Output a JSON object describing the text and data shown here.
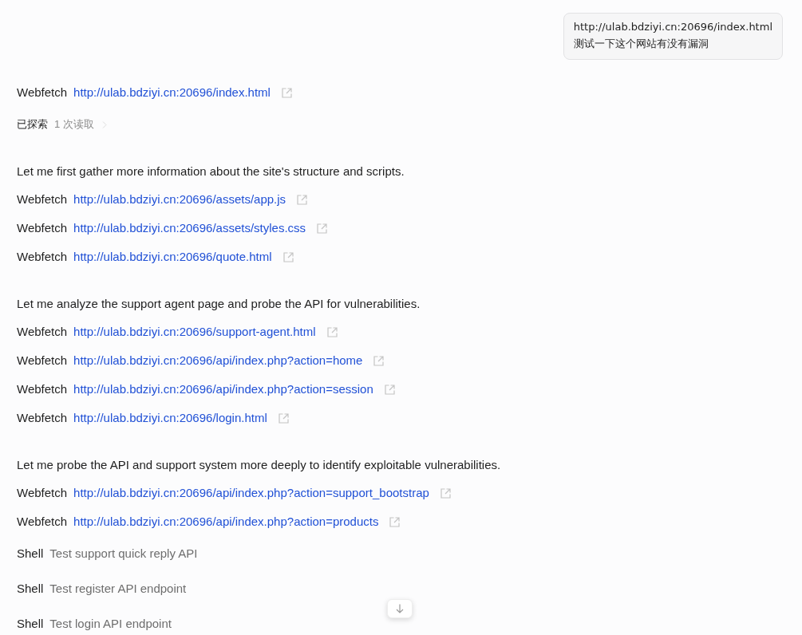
{
  "user_message": {
    "lines": [
      "http://ulab.bdziyi.cn:20696/index.html",
      "测试一下这个网站有没有漏洞"
    ]
  },
  "items": [
    {
      "kind": "fetch",
      "tool": "Webfetch",
      "url": "http://ulab.bdziyi.cn:20696/index.html"
    },
    {
      "kind": "explored",
      "label": "已探索",
      "detail": "1 次读取",
      "expanded": false
    },
    {
      "kind": "text",
      "text": "Let me first gather more information about the site's structure and scripts."
    },
    {
      "kind": "fetch",
      "tool": "Webfetch",
      "url": "http://ulab.bdziyi.cn:20696/assets/app.js"
    },
    {
      "kind": "fetch",
      "tool": "Webfetch",
      "url": "http://ulab.bdziyi.cn:20696/assets/styles.css"
    },
    {
      "kind": "fetch",
      "tool": "Webfetch",
      "url": "http://ulab.bdziyi.cn:20696/quote.html"
    },
    {
      "kind": "text",
      "text": "Let me analyze the support agent page and probe the API for vulnerabilities."
    },
    {
      "kind": "fetch",
      "tool": "Webfetch",
      "url": "http://ulab.bdziyi.cn:20696/support-agent.html"
    },
    {
      "kind": "fetch",
      "tool": "Webfetch",
      "url": "http://ulab.bdziyi.cn:20696/api/index.php?action=home"
    },
    {
      "kind": "fetch",
      "tool": "Webfetch",
      "url": "http://ulab.bdziyi.cn:20696/api/index.php?action=session"
    },
    {
      "kind": "fetch",
      "tool": "Webfetch",
      "url": "http://ulab.bdziyi.cn:20696/login.html"
    },
    {
      "kind": "text",
      "text": "Let me probe the API and support system more deeply to identify exploitable vulnerabilities."
    },
    {
      "kind": "fetch",
      "tool": "Webfetch",
      "url": "http://ulab.bdziyi.cn:20696/api/index.php?action=support_bootstrap"
    },
    {
      "kind": "fetch",
      "tool": "Webfetch",
      "url": "http://ulab.bdziyi.cn:20696/api/index.php?action=products"
    },
    {
      "kind": "shell",
      "tool": "Shell",
      "description": "Test support quick reply API"
    },
    {
      "kind": "shell",
      "tool": "Shell",
      "description": "Test register API endpoint"
    },
    {
      "kind": "shell",
      "tool": "Shell",
      "description": "Test login API endpoint"
    }
  ]
}
